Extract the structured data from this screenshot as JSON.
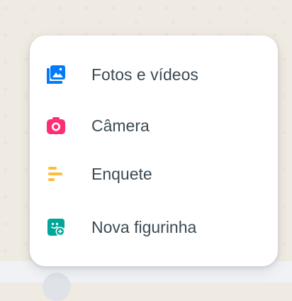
{
  "attach_menu": {
    "items": [
      {
        "label": "Fotos e vídeos",
        "icon": "photos-icon",
        "color": "#007bfc"
      },
      {
        "label": "Câmera",
        "icon": "camera-icon",
        "color": "#ff2e74"
      },
      {
        "label": "Enquete",
        "icon": "poll-icon",
        "color": "#ffbc38"
      },
      {
        "label": "Nova figurinha",
        "icon": "sticker-icon",
        "color": "#02a698"
      }
    ]
  }
}
